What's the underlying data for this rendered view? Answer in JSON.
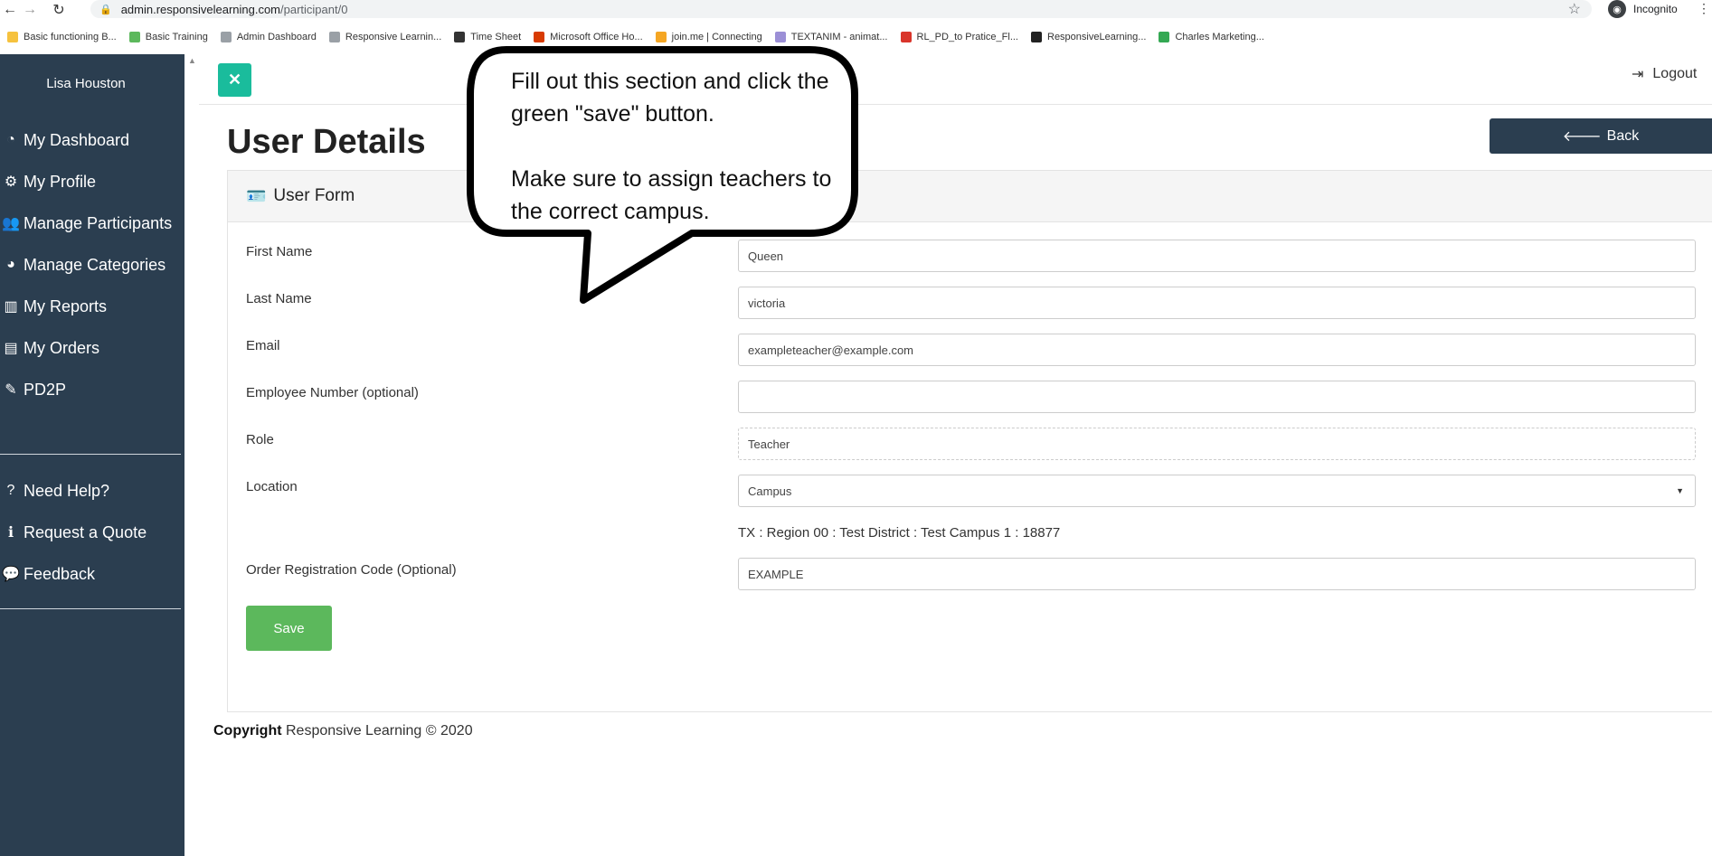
{
  "browser": {
    "url_host": "admin.responsivelearning.com",
    "url_path": "/participant/0",
    "incognito_label": "Incognito",
    "bookmarks": [
      {
        "label": "Basic functioning B...",
        "icon": "folder-icon",
        "color": "#f6c23e"
      },
      {
        "label": "Basic Training",
        "icon": "leaf-icon",
        "color": "#5cb85c"
      },
      {
        "label": "Admin Dashboard",
        "icon": "page-icon",
        "color": "#9aa0a6"
      },
      {
        "label": "Responsive Learnin...",
        "icon": "page-icon",
        "color": "#9aa0a6"
      },
      {
        "label": "Time Sheet",
        "icon": "globe-icon",
        "color": "#333333"
      },
      {
        "label": "Microsoft Office Ho...",
        "icon": "office-icon",
        "color": "#d83b01"
      },
      {
        "label": "join.me | Connecting",
        "icon": "joinme-icon",
        "color": "#f5a623"
      },
      {
        "label": "TEXTANIM - animat...",
        "icon": "textanim-icon",
        "color": "#9b8fd6"
      },
      {
        "label": "RL_PD_to Pratice_Fl...",
        "icon": "pdf-icon",
        "color": "#d9352b"
      },
      {
        "label": "ResponsiveLearning...",
        "icon": "angular-icon",
        "color": "#222222"
      },
      {
        "label": "Charles Marketing...",
        "icon": "drive-icon",
        "color": "#34a853"
      }
    ]
  },
  "sidebar": {
    "user_name": "Lisa Houston",
    "items": [
      {
        "label": "My Dashboard",
        "icon": "dashboard-icon",
        "glyph": "◔"
      },
      {
        "label": "My Profile",
        "icon": "gears-icon",
        "glyph": "⚙"
      },
      {
        "label": "Manage Participants",
        "icon": "users-icon",
        "glyph": "👥"
      },
      {
        "label": "Manage Categories",
        "icon": "pie-chart-icon",
        "glyph": "◕"
      },
      {
        "label": "My Reports",
        "icon": "bar-chart-icon",
        "glyph": "▥"
      },
      {
        "label": "My Orders",
        "icon": "file-icon",
        "glyph": "▤"
      },
      {
        "label": "PD2P",
        "icon": "pencil-icon",
        "glyph": "✎"
      }
    ],
    "help_items": [
      {
        "label": "Need Help?",
        "icon": "question-circle-icon",
        "glyph": "?"
      },
      {
        "label": "Request a Quote",
        "icon": "info-circle-icon",
        "glyph": "ℹ"
      },
      {
        "label": "Feedback",
        "icon": "comments-icon",
        "glyph": "💬"
      }
    ]
  },
  "header": {
    "logout_label": "Logout",
    "back_label": "Back"
  },
  "page": {
    "title": "User Details",
    "panel_title": "User Form"
  },
  "form": {
    "first_name_label": "First Name",
    "first_name_value": "Queen",
    "last_name_label": "Last Name",
    "last_name_value": "victoria",
    "email_label": "Email",
    "email_value": "exampleteacher@example.com",
    "employee_number_label": "Employee Number (optional)",
    "employee_number_value": "",
    "role_label": "Role",
    "role_value": "Teacher",
    "location_label": "Location",
    "location_value": "Campus",
    "location_path": "TX : Region 00 : Test District : Test Campus 1 : 18877",
    "order_code_label": "Order Registration Code (Optional)",
    "order_code_value": "EXAMPLE",
    "save_label": "Save"
  },
  "footer": {
    "copyright_bold": "Copyright",
    "copyright_text": "Responsive Learning © 2020"
  },
  "callout": {
    "line1": "Fill out this section and click the green \"save\" button.",
    "line2": "Make sure to assign teachers to the correct campus."
  },
  "colors": {
    "sidebar_bg": "#2b3e50",
    "accent_teal": "#1abc9c",
    "save_green": "#5cb85c"
  }
}
